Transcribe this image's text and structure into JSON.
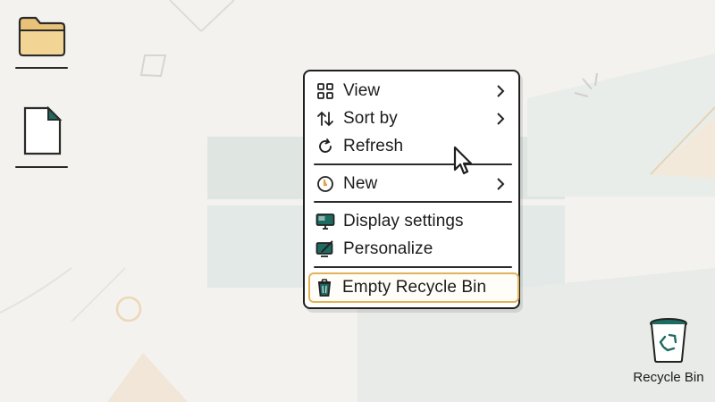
{
  "context_menu": {
    "items": [
      {
        "label": "View",
        "icon": "view-grid-icon",
        "has_submenu": true
      },
      {
        "label": "Sort by",
        "icon": "sort-arrows-icon",
        "has_submenu": true
      },
      {
        "label": "Refresh",
        "icon": "refresh-icon",
        "has_submenu": false
      },
      {
        "label": "New",
        "icon": "new-plus-icon",
        "has_submenu": true
      },
      {
        "label": "Display settings",
        "icon": "display-monitor-icon",
        "has_submenu": false
      },
      {
        "label": "Personalize",
        "icon": "personalize-brush-icon",
        "has_submenu": false
      },
      {
        "label": "Empty Recycle Bin",
        "icon": "trash-icon",
        "has_submenu": false,
        "highlighted": true
      }
    ]
  },
  "desktop": {
    "icons": [
      {
        "label": "Recycle Bin",
        "icon": "recycle-bin-icon"
      }
    ],
    "unlabeled_icons": [
      "folder-icon",
      "file-icon"
    ]
  },
  "colors": {
    "background": "#f3f2ef",
    "accent_highlight": "#e0b35a",
    "teal": "#1e6b62",
    "folder": "#e9c27a"
  }
}
